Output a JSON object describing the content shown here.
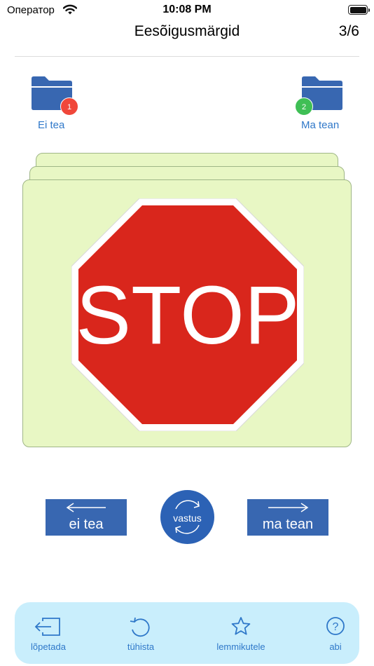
{
  "status_bar": {
    "carrier": "Оператор",
    "time": "10:08 PM",
    "icons": [
      "wifi-icon",
      "battery-icon"
    ]
  },
  "nav": {
    "title": "Eesõigusmärgid",
    "counter": "3/6"
  },
  "folders": {
    "left": {
      "label": "Ei tea",
      "count": "1",
      "icon": "folder-icon",
      "badge_color": "#f0473a"
    },
    "right": {
      "label": "Ma tean",
      "count": "2",
      "icon": "folder-icon",
      "badge_color": "#3fbf55"
    }
  },
  "card": {
    "sign_text": "STOP",
    "background": "#e8f7c4",
    "sign_color": "#d9261c"
  },
  "actions": {
    "left_label": "ei tea",
    "center_label": "vastus",
    "right_label": "ma tean",
    "icons": [
      "arrow-left-icon",
      "flip-icon",
      "arrow-right-icon"
    ],
    "button_color": "#3867b1"
  },
  "tabbar": {
    "items": [
      {
        "label": "lõpetada",
        "icon": "exit-icon"
      },
      {
        "label": "tühista",
        "icon": "undo-icon"
      },
      {
        "label": "lemmikutele",
        "icon": "star-icon"
      },
      {
        "label": "abi",
        "icon": "help-icon"
      }
    ],
    "accent": "#2f78c9",
    "background": "#c9eefc"
  }
}
